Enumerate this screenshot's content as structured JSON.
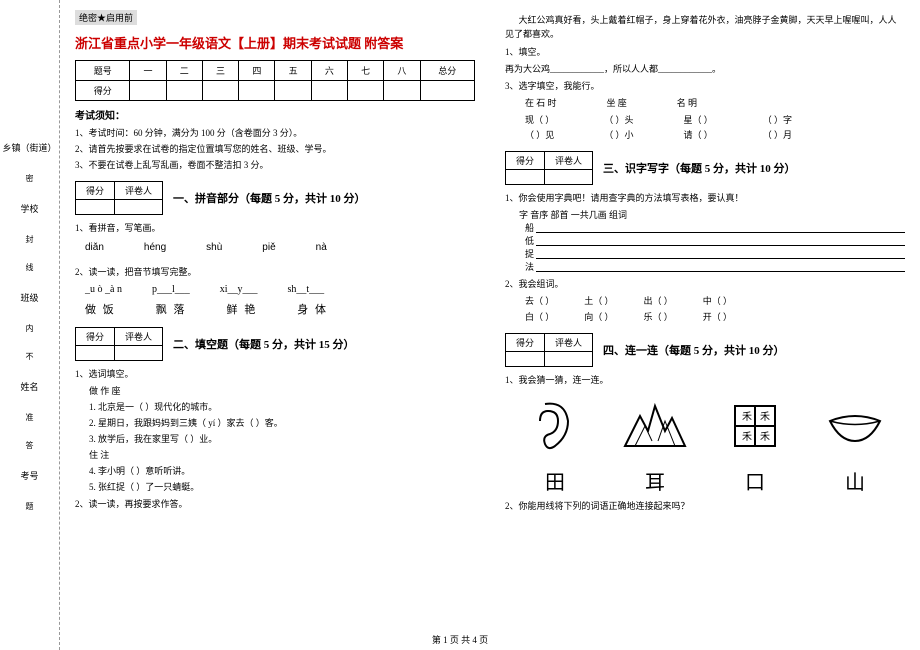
{
  "binding": {
    "fields": [
      "乡镇（街道）",
      "学校",
      "班级",
      "姓名",
      "考号"
    ],
    "markers": [
      "密",
      "封",
      "线",
      "内",
      "不",
      "准",
      "答",
      "题"
    ]
  },
  "secret": "绝密★启用前",
  "title": "浙江省重点小学一年级语文【上册】期末考试试题 附答案",
  "score_header": [
    "题号",
    "一",
    "二",
    "三",
    "四",
    "五",
    "六",
    "七",
    "八",
    "总分"
  ],
  "score_row_label": "得分",
  "notice_header": "考试须知：",
  "notices": [
    "1、考试时间：60 分钟，满分为 100 分（含卷面分 3 分）。",
    "2、请首先按要求在试卷的指定位置填写您的姓名、班级、学号。",
    "3、不要在试卷上乱写乱画，卷面不整洁扣 3 分。"
  ],
  "mini": {
    "c1": "得分",
    "c2": "评卷人"
  },
  "sec1": {
    "title": "一、拼音部分（每题 5 分，共计 10 分）",
    "q1": "1、看拼音，写笔画。",
    "pinyin": [
      "diǎn",
      "hénɡ",
      "shù",
      "piě",
      "nà"
    ],
    "q2": "2、读一读，把音节填写完整。",
    "fills": [
      "_u ò _à n",
      "p___l___",
      "xi__y___",
      "sh__t___"
    ],
    "chars": [
      "做 饭",
      "飘 落",
      "鲜 艳",
      "身 体"
    ]
  },
  "sec2": {
    "title": "二、填空题（每题 5 分，共计 15 分）",
    "q1": "1、选词填空。",
    "words": "做    作    座",
    "items": [
      "1. 北京是一（    ）现代化的城市。",
      "2. 星期日，我跟妈妈到三姨（ yí ）家去（    ）客。",
      "3. 放学后，我在家里写（    ）业。"
    ],
    "words2": "住    注",
    "items2": [
      "4. 李小明（    ）意听听讲。",
      "5. 张红捉（    ）了一只蜻蜓。"
    ],
    "q2": "2、读一读，再按要求作答。"
  },
  "right_para": [
    "大红公鸡真好看，头上戴着红帽子，身上穿着花外衣，油亮脖子金黄脚，天天早上喔喔叫，人人见了都喜欢。",
    "1、填空。",
    "   再为大公鸡____________，所以人人都____________。",
    "3、选字填空，我能行。"
  ],
  "char_pairs": [
    [
      "在    石    时",
      "坐    座",
      "名    明"
    ],
    [
      "现（        ）",
      "（        ）头",
      "星（        ）",
      "（        ）字"
    ],
    [
      "（        ）见",
      "（        ）小",
      "请（        ）",
      "（        ）月"
    ]
  ],
  "sec3": {
    "title": "三、识字写字（每题 5 分，共计 10 分）",
    "q1": "1、你会使用字典吧！请用查字典的方法填写表格，要认真！",
    "dict_header": "字        音序        部首        一共几画        组词",
    "dict_words": [
      "船",
      "低",
      "捉",
      "法"
    ],
    "q2": "2、我会组词。",
    "rows": [
      [
        "去（        ）",
        "土（        ）",
        "出（        ）",
        "中（        ）"
      ],
      [
        "白（        ）",
        "向（        ）",
        "乐（        ）",
        "开（        ）"
      ]
    ]
  },
  "sec4": {
    "title": "四、连一连（每题 5 分，共计 10 分）",
    "q1": "1、我会猜一猜，连一连。",
    "big_chars": [
      "田",
      "耳",
      "口",
      "山"
    ],
    "q2": "2、你能用线将下列的词语正确地连接起来吗？"
  },
  "footer": "第 1 页 共 4 页"
}
